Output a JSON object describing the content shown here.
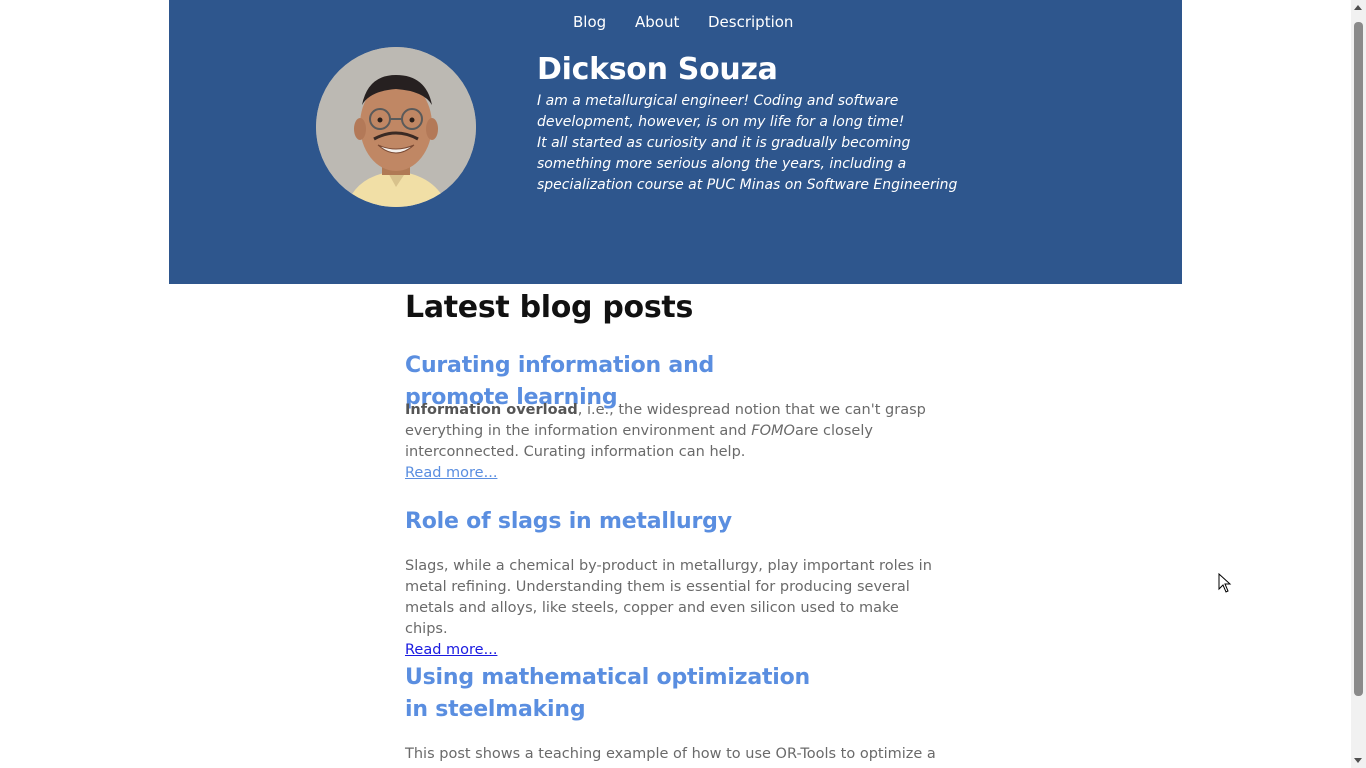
{
  "nav": {
    "items": [
      {
        "label": "Blog"
      },
      {
        "label": "About"
      },
      {
        "label": "Description"
      }
    ]
  },
  "profile": {
    "name": "Dickson Souza",
    "bio_line1": "I am a metallurgical engineer! Coding and software development, however, is on my life for a long time!",
    "bio_line2": "It all started as curiosity and it is gradually becoming something more serious along the years, including a specialization course at PUC Minas on Software Engineering"
  },
  "main": {
    "heading": "Latest blog posts",
    "posts": [
      {
        "title": "Curating information and promote learning",
        "desc_bold": "Information overload",
        "desc_text1": ", i.e., the widespread notion that we can't grasp everything in the information environment and ",
        "desc_italic": "FOMO",
        "desc_text2": "are closely interconnected. Curating information can help.",
        "read_more": "Read more..."
      },
      {
        "title": "Role of slags in metallurgy",
        "desc": "Slags, while a chemical by-product in metallurgy, play important roles in metal refining. Understanding them is essential for producing several metals and alloys, like steels, copper and even silicon used to make chips.",
        "read_more": "Read more..."
      },
      {
        "title": "Using mathematical optimization in steelmaking",
        "desc": "This post shows a teaching example of how to use OR-Tools to optimize a"
      }
    ]
  },
  "colors": {
    "header_bg": "#2e568d",
    "post_title": "#5a8ee0",
    "body_text": "#6a6a6a",
    "link_unvisited": "#1a1ae0"
  },
  "icons": {
    "avatar": "profile-photo",
    "cursor": "mouse-pointer-icon"
  }
}
